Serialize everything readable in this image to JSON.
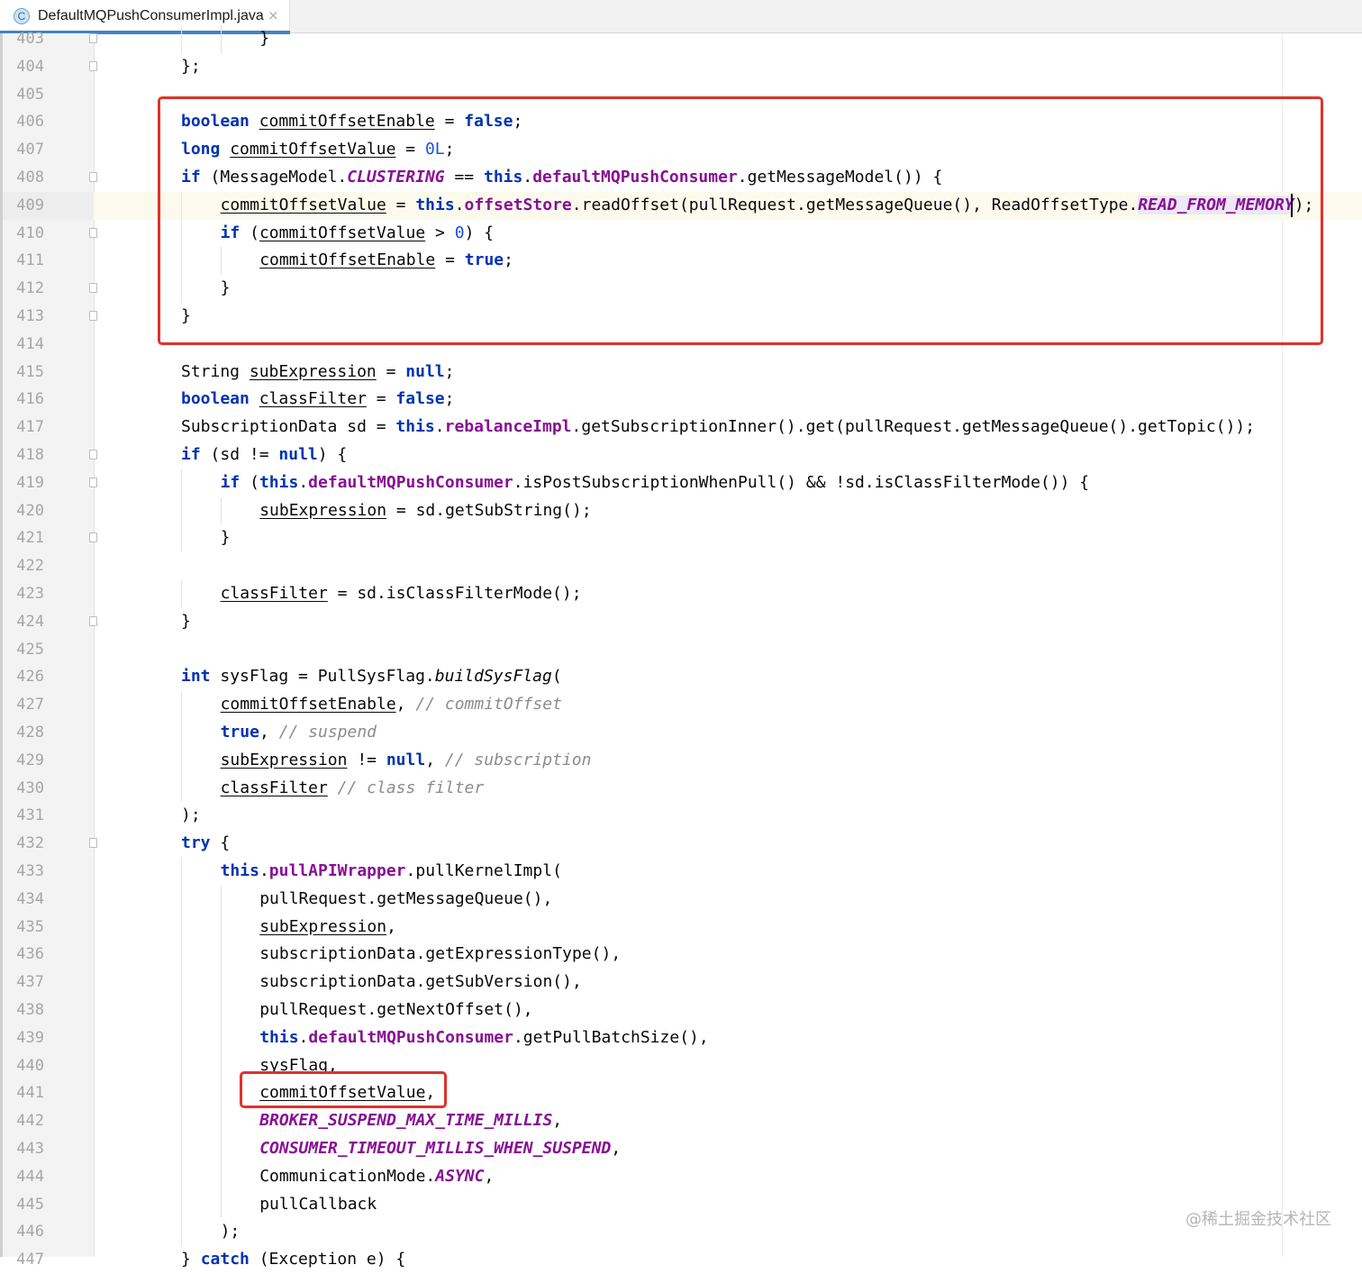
{
  "tab": {
    "icon": "C",
    "title": "DefaultMQPushConsumerImpl.java",
    "close_glyph": "×"
  },
  "current_line": 409,
  "lines": [
    {
      "n": 403,
      "indent": 2,
      "fold": true,
      "tokens": [
        [
          "p",
          "}"
        ]
      ]
    },
    {
      "n": 404,
      "indent": 0,
      "fold": true,
      "tokens": [
        [
          "p",
          "};"
        ]
      ]
    },
    {
      "n": 405,
      "indent": 0,
      "fold": false,
      "tokens": []
    },
    {
      "n": 406,
      "indent": 0,
      "fold": false,
      "tokens": [
        [
          "kw",
          "boolean"
        ],
        [
          "p",
          " "
        ],
        [
          "var",
          "commitOffsetEnable"
        ],
        [
          "p",
          " = "
        ],
        [
          "kw",
          "false"
        ],
        [
          "p",
          ";"
        ]
      ]
    },
    {
      "n": 407,
      "indent": 0,
      "fold": false,
      "tokens": [
        [
          "kw",
          "long"
        ],
        [
          "p",
          " "
        ],
        [
          "var",
          "commitOffsetValue"
        ],
        [
          "p",
          " = "
        ],
        [
          "num",
          "0L"
        ],
        [
          "p",
          ";"
        ]
      ]
    },
    {
      "n": 408,
      "indent": 0,
      "fold": true,
      "tokens": [
        [
          "kw",
          "if"
        ],
        [
          "p",
          " (MessageModel."
        ],
        [
          "sfld",
          "CLUSTERING"
        ],
        [
          "p",
          " == "
        ],
        [
          "kw",
          "this"
        ],
        [
          "p",
          "."
        ],
        [
          "fld",
          "defaultMQPushConsumer"
        ],
        [
          "p",
          ".getMessageModel()) {"
        ]
      ]
    },
    {
      "n": 409,
      "indent": 1,
      "fold": false,
      "tokens": [
        [
          "var",
          "commitOffsetValue"
        ],
        [
          "p",
          " = "
        ],
        [
          "kw",
          "this"
        ],
        [
          "p",
          "."
        ],
        [
          "fld",
          "offsetStore"
        ],
        [
          "p",
          ".readOffset(pullRequest.getMessageQueue(), ReadOffsetType."
        ],
        [
          "sfldhl",
          "READ_FROM_MEMORY"
        ],
        [
          "p",
          ");"
        ]
      ]
    },
    {
      "n": 410,
      "indent": 1,
      "fold": true,
      "tokens": [
        [
          "kw",
          "if"
        ],
        [
          "p",
          " ("
        ],
        [
          "var",
          "commitOffsetValue"
        ],
        [
          "p",
          " > "
        ],
        [
          "num",
          "0"
        ],
        [
          "p",
          ") {"
        ]
      ]
    },
    {
      "n": 411,
      "indent": 2,
      "fold": false,
      "tokens": [
        [
          "var",
          "commitOffsetEnable"
        ],
        [
          "p",
          " = "
        ],
        [
          "kw",
          "true"
        ],
        [
          "p",
          ";"
        ]
      ]
    },
    {
      "n": 412,
      "indent": 1,
      "fold": true,
      "tokens": [
        [
          "p",
          "}"
        ]
      ]
    },
    {
      "n": 413,
      "indent": 0,
      "fold": true,
      "tokens": [
        [
          "p",
          "}"
        ]
      ]
    },
    {
      "n": 414,
      "indent": 0,
      "fold": false,
      "tokens": []
    },
    {
      "n": 415,
      "indent": 0,
      "fold": false,
      "tokens": [
        [
          "p",
          "String "
        ],
        [
          "var",
          "subExpression"
        ],
        [
          "p",
          " = "
        ],
        [
          "kw",
          "null"
        ],
        [
          "p",
          ";"
        ]
      ]
    },
    {
      "n": 416,
      "indent": 0,
      "fold": false,
      "tokens": [
        [
          "kw",
          "boolean"
        ],
        [
          "p",
          " "
        ],
        [
          "var",
          "classFilter"
        ],
        [
          "p",
          " = "
        ],
        [
          "kw",
          "false"
        ],
        [
          "p",
          ";"
        ]
      ]
    },
    {
      "n": 417,
      "indent": 0,
      "fold": false,
      "tokens": [
        [
          "p",
          "SubscriptionData sd = "
        ],
        [
          "kw",
          "this"
        ],
        [
          "p",
          "."
        ],
        [
          "fld",
          "rebalanceImpl"
        ],
        [
          "p",
          ".getSubscriptionInner().get(pullRequest.getMessageQueue().getTopic());"
        ]
      ]
    },
    {
      "n": 418,
      "indent": 0,
      "fold": true,
      "tokens": [
        [
          "kw",
          "if"
        ],
        [
          "p",
          " (sd != "
        ],
        [
          "kw",
          "null"
        ],
        [
          "p",
          ") {"
        ]
      ]
    },
    {
      "n": 419,
      "indent": 1,
      "fold": true,
      "tokens": [
        [
          "kw",
          "if"
        ],
        [
          "p",
          " ("
        ],
        [
          "kw",
          "this"
        ],
        [
          "p",
          "."
        ],
        [
          "fld",
          "defaultMQPushConsumer"
        ],
        [
          "p",
          ".isPostSubscriptionWhenPull() && !sd.isClassFilterMode()) {"
        ]
      ]
    },
    {
      "n": 420,
      "indent": 2,
      "fold": false,
      "tokens": [
        [
          "var",
          "subExpression"
        ],
        [
          "p",
          " = sd.getSubString();"
        ]
      ]
    },
    {
      "n": 421,
      "indent": 1,
      "fold": true,
      "tokens": [
        [
          "p",
          "}"
        ]
      ]
    },
    {
      "n": 422,
      "indent": 0,
      "fold": false,
      "tokens": []
    },
    {
      "n": 423,
      "indent": 1,
      "fold": false,
      "tokens": [
        [
          "var",
          "classFilter"
        ],
        [
          "p",
          " = sd.isClassFilterMode();"
        ]
      ]
    },
    {
      "n": 424,
      "indent": 0,
      "fold": true,
      "tokens": [
        [
          "p",
          "}"
        ]
      ]
    },
    {
      "n": 425,
      "indent": 0,
      "fold": false,
      "tokens": []
    },
    {
      "n": 426,
      "indent": 0,
      "fold": false,
      "tokens": [
        [
          "kw",
          "int"
        ],
        [
          "p",
          " sysFlag = PullSysFlag."
        ],
        [
          "smeth",
          "buildSysFlag"
        ],
        [
          "p",
          "("
        ]
      ]
    },
    {
      "n": 427,
      "indent": 1,
      "fold": false,
      "tokens": [
        [
          "var",
          "commitOffsetEnable"
        ],
        [
          "p",
          ", "
        ],
        [
          "cmt",
          "// commitOffset"
        ]
      ]
    },
    {
      "n": 428,
      "indent": 1,
      "fold": false,
      "tokens": [
        [
          "kw",
          "true"
        ],
        [
          "p",
          ", "
        ],
        [
          "cmt",
          "// suspend"
        ]
      ]
    },
    {
      "n": 429,
      "indent": 1,
      "fold": false,
      "tokens": [
        [
          "var",
          "subExpression"
        ],
        [
          "p",
          " != "
        ],
        [
          "kw",
          "null"
        ],
        [
          "p",
          ", "
        ],
        [
          "cmt",
          "// subscription"
        ]
      ]
    },
    {
      "n": 430,
      "indent": 1,
      "fold": false,
      "tokens": [
        [
          "var",
          "classFilter"
        ],
        [
          "p",
          " "
        ],
        [
          "cmt",
          "// class filter"
        ]
      ]
    },
    {
      "n": 431,
      "indent": 0,
      "fold": false,
      "tokens": [
        [
          "p",
          ");"
        ]
      ]
    },
    {
      "n": 432,
      "indent": 0,
      "fold": true,
      "tokens": [
        [
          "kw",
          "try"
        ],
        [
          "p",
          " {"
        ]
      ]
    },
    {
      "n": 433,
      "indent": 1,
      "fold": false,
      "tokens": [
        [
          "kw",
          "this"
        ],
        [
          "p",
          "."
        ],
        [
          "fld",
          "pullAPIWrapper"
        ],
        [
          "p",
          ".pullKernelImpl("
        ]
      ]
    },
    {
      "n": 434,
      "indent": 2,
      "fold": false,
      "tokens": [
        [
          "p",
          "pullRequest.getMessageQueue(),"
        ]
      ]
    },
    {
      "n": 435,
      "indent": 2,
      "fold": false,
      "tokens": [
        [
          "var",
          "subExpression"
        ],
        [
          "p",
          ","
        ]
      ]
    },
    {
      "n": 436,
      "indent": 2,
      "fold": false,
      "tokens": [
        [
          "p",
          "subscriptionData.getExpressionType(),"
        ]
      ]
    },
    {
      "n": 437,
      "indent": 2,
      "fold": false,
      "tokens": [
        [
          "p",
          "subscriptionData.getSubVersion(),"
        ]
      ]
    },
    {
      "n": 438,
      "indent": 2,
      "fold": false,
      "tokens": [
        [
          "p",
          "pullRequest.getNextOffset(),"
        ]
      ]
    },
    {
      "n": 439,
      "indent": 2,
      "fold": false,
      "tokens": [
        [
          "kw",
          "this"
        ],
        [
          "p",
          "."
        ],
        [
          "fld",
          "defaultMQPushConsumer"
        ],
        [
          "p",
          ".getPullBatchSize(),"
        ]
      ]
    },
    {
      "n": 440,
      "indent": 2,
      "fold": false,
      "tokens": [
        [
          "p",
          "sysFlag,"
        ]
      ]
    },
    {
      "n": 441,
      "indent": 2,
      "fold": false,
      "tokens": [
        [
          "var",
          "commitOffsetValue"
        ],
        [
          "p",
          ","
        ]
      ]
    },
    {
      "n": 442,
      "indent": 2,
      "fold": false,
      "tokens": [
        [
          "sfld",
          "BROKER_SUSPEND_MAX_TIME_MILLIS"
        ],
        [
          "p",
          ","
        ]
      ]
    },
    {
      "n": 443,
      "indent": 2,
      "fold": false,
      "tokens": [
        [
          "sfld",
          "CONSUMER_TIMEOUT_MILLIS_WHEN_SUSPEND"
        ],
        [
          "p",
          ","
        ]
      ]
    },
    {
      "n": 444,
      "indent": 2,
      "fold": false,
      "tokens": [
        [
          "p",
          "CommunicationMode."
        ],
        [
          "sfld",
          "ASYNC"
        ],
        [
          "p",
          ","
        ]
      ]
    },
    {
      "n": 445,
      "indent": 2,
      "fold": false,
      "tokens": [
        [
          "p",
          "pullCallback"
        ]
      ]
    },
    {
      "n": 446,
      "indent": 1,
      "fold": false,
      "tokens": [
        [
          "p",
          ");"
        ]
      ]
    },
    {
      "n": 447,
      "indent": 0,
      "fold": false,
      "tokens": [
        [
          "p",
          "} "
        ],
        [
          "kw",
          "catch"
        ],
        [
          "p",
          " (Exception e) {"
        ]
      ]
    }
  ],
  "watermark": "@稀土掘金技术社区"
}
